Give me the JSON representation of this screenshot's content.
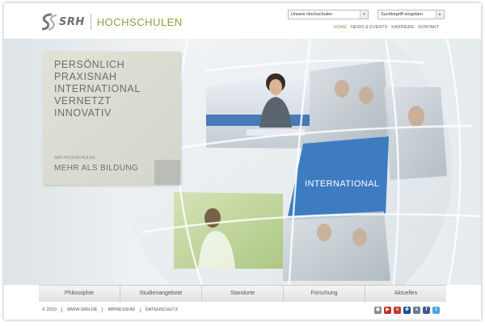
{
  "header": {
    "logo_srh": "SRH",
    "logo_text": "HOCHSCHULEN",
    "hochschulen_select": "Unsere Hochschulen",
    "search_placeholder": "Suchbegriff eingeben",
    "nav": [
      {
        "label": "HOME",
        "active": true
      },
      {
        "label": "NEWS & EVENTS",
        "active": false
      },
      {
        "label": "KARRIERE",
        "active": false
      },
      {
        "label": "KONTAKT",
        "active": false
      }
    ]
  },
  "hero": {
    "claims": [
      "PERSÖNLICH",
      "PRAXISNAH",
      "INTERNATIONAL",
      "VERNETZT",
      "INNOVATIV"
    ],
    "kicker": "SRH HOCHSCHULEN",
    "slogan": "MEHR ALS BILDUNG",
    "highlight_label": "INTERNATIONAL"
  },
  "tabs": [
    "Philosophie",
    "Studienangebote",
    "Standorte",
    "Forschung",
    "Aktuelles"
  ],
  "footer": {
    "copyright": "© 2010",
    "links": [
      "WWW.SRH.DE",
      "IMPRESSUM",
      "DATENSCHUTZ"
    ],
    "social": [
      {
        "name": "chrome-icon",
        "color": "#8a8a8a"
      },
      {
        "name": "youtube-icon",
        "color": "#c4302b"
      },
      {
        "name": "studivz-icon",
        "color": "#c0392b"
      },
      {
        "name": "uk-flag-icon",
        "color": "#1f4e96"
      },
      {
        "name": "xing-icon",
        "color": "#6b7b8c"
      },
      {
        "name": "facebook-icon",
        "color": "#3b5998"
      },
      {
        "name": "twitter-icon",
        "color": "#4aa3df"
      }
    ]
  },
  "colors": {
    "brand_green": "#8aa23c",
    "international_blue": "#3e7cc2",
    "logo_gray": "#6e6e6e"
  }
}
